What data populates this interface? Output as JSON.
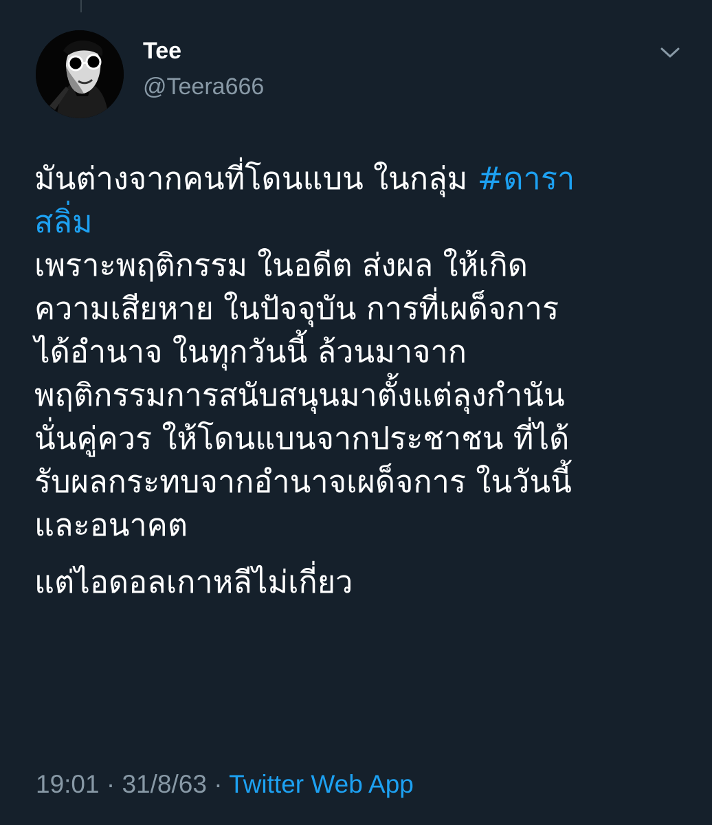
{
  "user": {
    "display_name": "Tee",
    "handle": "@Teera666",
    "avatar_icon": "avatar-silhouette-icon"
  },
  "menu": {
    "icon": "chevron-down-icon"
  },
  "tweet": {
    "para1": {
      "line1_text": "มันต่างจากคนที่โดนแบน ในกลุ่ม ",
      "line1_hashtag": "#ดารา",
      "line2_hashtag": "สลิ่ม",
      "lines": [
        "เพราะพฤติกรรม ในอดีต ส่งผล ให้เกิด",
        "ความเสียหาย ในปัจจุบัน การที่เผด็จการ",
        "ได้อำนาจ ในทุกวันนี้ ล้วนมาจาก",
        "พฤติกรรมการสนับสนุนมาตั้งแต่ลุงกำนัน",
        "นั่นคู่ควร ให้โดนแบนจากประชาชน ที่ได้",
        "รับผลกระทบจากอำนาจเผด็จการ ในวันนี้",
        "และอนาคต"
      ]
    },
    "para2": "แต่ไอดอลเกาหลีไม่เกี่ยว"
  },
  "meta": {
    "time": "19:01",
    "sep1": " · ",
    "date": "31/8/63",
    "sep2": " · ",
    "source": "Twitter Web App"
  },
  "colors": {
    "background": "#15202b",
    "text": "#ffffff",
    "secondary": "#8899a6",
    "link": "#1da1f2"
  }
}
